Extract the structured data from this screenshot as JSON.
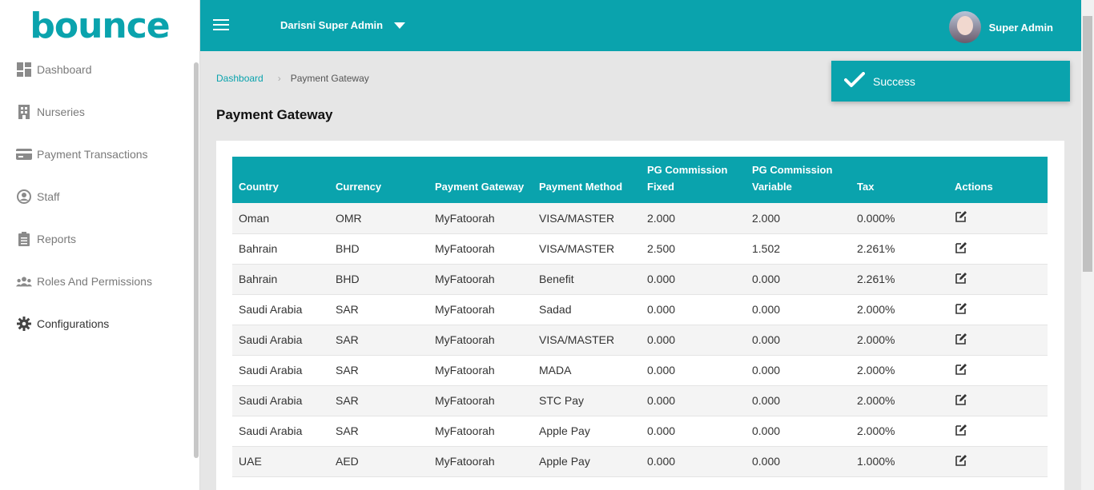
{
  "app": {
    "logo_text": "bounce"
  },
  "sidebar": {
    "items": [
      {
        "label": "Dashboard",
        "icon": "dashboard-icon"
      },
      {
        "label": "Nurseries",
        "icon": "building-icon"
      },
      {
        "label": "Payment Transactions",
        "icon": "credit-card-icon"
      },
      {
        "label": "Staff",
        "icon": "user-circle-icon"
      },
      {
        "label": "Reports",
        "icon": "clipboard-icon"
      },
      {
        "label": "Roles And Permissions",
        "icon": "users-icon"
      },
      {
        "label": "Configurations",
        "icon": "gear-icon"
      }
    ]
  },
  "header": {
    "org_select": "Darisni Super Admin",
    "user_name": "Super Admin"
  },
  "breadcrumb": {
    "home": "Dashboard",
    "separator": "›",
    "current": "Payment Gateway"
  },
  "page": {
    "title": "Payment Gateway"
  },
  "toast": {
    "message": "Success"
  },
  "table": {
    "columns": [
      "Country",
      "Currency",
      "Payment Gateway",
      "Payment Method",
      "PG Commission Fixed",
      "PG Commission Variable",
      "Tax",
      "Actions"
    ],
    "rows": [
      [
        "Oman",
        "OMR",
        "MyFatoorah",
        "VISA/MASTER",
        "2.000",
        "2.000",
        "0.000%"
      ],
      [
        "Bahrain",
        "BHD",
        "MyFatoorah",
        "VISA/MASTER",
        "2.500",
        "1.502",
        "2.261%"
      ],
      [
        "Bahrain",
        "BHD",
        "MyFatoorah",
        "Benefit",
        "0.000",
        "0.000",
        "2.261%"
      ],
      [
        "Saudi Arabia",
        "SAR",
        "MyFatoorah",
        "Sadad",
        "0.000",
        "0.000",
        "2.000%"
      ],
      [
        "Saudi Arabia",
        "SAR",
        "MyFatoorah",
        "VISA/MASTER",
        "0.000",
        "0.000",
        "2.000%"
      ],
      [
        "Saudi Arabia",
        "SAR",
        "MyFatoorah",
        "MADA",
        "0.000",
        "0.000",
        "2.000%"
      ],
      [
        "Saudi Arabia",
        "SAR",
        "MyFatoorah",
        "STC Pay",
        "0.000",
        "0.000",
        "2.000%"
      ],
      [
        "Saudi Arabia",
        "SAR",
        "MyFatoorah",
        "Apple Pay",
        "0.000",
        "0.000",
        "2.000%"
      ],
      [
        "UAE",
        "AED",
        "MyFatoorah",
        "Apple Pay",
        "0.000",
        "0.000",
        "1.000%"
      ]
    ]
  },
  "colors": {
    "brand": "#0aa3ad",
    "logo_dot": "#c8d640"
  }
}
